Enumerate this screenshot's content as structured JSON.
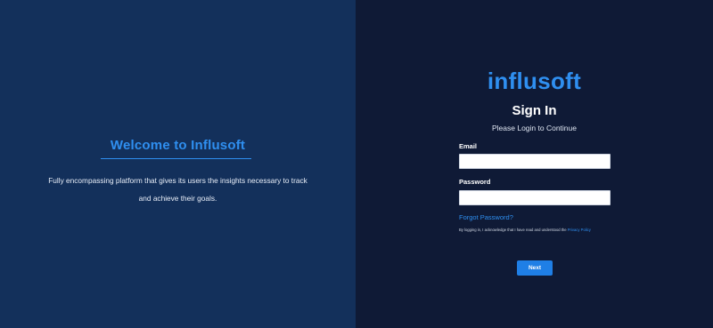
{
  "left": {
    "title": "Welcome to Influsoft",
    "description_line1": "Fully encompassing platform that gives its users the insights necessary to track",
    "description_line2": "and achieve their goals."
  },
  "right": {
    "logo_text": "influsoft",
    "title": "Sign In",
    "subtitle": "Please Login to Continue",
    "email_label": "Email",
    "email_value": "",
    "password_label": "Password",
    "password_value": "",
    "forgot_password": "Forgot Password?",
    "legal_text": "By logging in, I acknowledge that I have read and understood the",
    "privacy_link": "Privacy Policy",
    "next_button": "Next"
  },
  "colors": {
    "left_background": "#13305b",
    "right_background": "#0f1a36",
    "accent": "#2f8ff0",
    "button": "#1f7fe6"
  }
}
